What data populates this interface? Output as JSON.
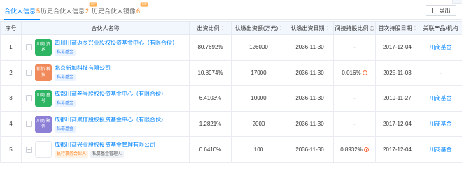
{
  "tabs": [
    {
      "label": "合伙人信息",
      "count": "5",
      "vip": ""
    },
    {
      "label": "历史合伙人信息",
      "count": "2",
      "vip": "VIP"
    },
    {
      "label": "历史合伙人镜像",
      "count": "6",
      "vip": "VIP"
    }
  ],
  "export_label": "导出",
  "columns": {
    "seq": "序号",
    "partner": "合伙人名称",
    "ratio": "出资比例",
    "subscribed": "认缴出资额(万元)",
    "due_date": "认缴出资日期",
    "indirect": "间接持股比例",
    "first_date": "首次持股日期",
    "related": "关联产品/机构"
  },
  "rows": [
    {
      "seq": "1",
      "logo": "川商 资乡",
      "logo_color": "#2db563",
      "name": "四川川商返乡兴业股权投资基金中心（有限合伙）",
      "tags": [
        {
          "text": "私募基金",
          "style": "blue"
        }
      ],
      "ratio": "80.7692%",
      "subscribed": "126000",
      "due_date": "2036-11-30",
      "indirect": "-",
      "first_date": "2017-12-04",
      "related": "川商基金"
    },
    {
      "seq": "2",
      "logo": "新加 科技",
      "logo_color": "#f08a5a",
      "name": "北京新加科技有限公司",
      "tags": [
        {
          "text": "私募基金",
          "style": "blue"
        }
      ],
      "ratio": "10.8974%",
      "subscribed": "17000",
      "due_date": "2036-11-30",
      "indirect": "0.016%",
      "first_date": "2025-11-03",
      "related": "-"
    },
    {
      "seq": "3",
      "logo": "川商 叁号",
      "logo_color": "#2db563",
      "name": "成都川商叁号股权投资基金中心（有限合伙）",
      "tags": [
        {
          "text": "私募基金",
          "style": "blue"
        }
      ],
      "ratio": "6.4103%",
      "subscribed": "10000",
      "due_date": "2036-11-30",
      "indirect": "-",
      "first_date": "2019-11-27",
      "related": "川商基金"
    },
    {
      "seq": "4",
      "logo": "川商 聚信",
      "logo_color": "#8c7fd6",
      "name": "成都川商聚信股权投资基金中心（有限合伙）",
      "tags": [
        {
          "text": "私募基金",
          "style": "blue"
        }
      ],
      "ratio": "1.2821%",
      "subscribed": "2000",
      "due_date": "2036-11-30",
      "indirect": "-",
      "first_date": "2017-12-04",
      "related": "川商基金"
    },
    {
      "seq": "5",
      "logo": "",
      "logo_color": "#ffffff",
      "name": "成都川商兴业股权投资基金管理有限公司",
      "tags": [
        {
          "text": "执行事务合伙人",
          "style": "orange"
        },
        {
          "text": "私募基金管理人",
          "style": "grey"
        }
      ],
      "ratio": "0.6410%",
      "subscribed": "100",
      "due_date": "2036-11-30",
      "indirect": "0.8932%",
      "first_date": "2017-12-04",
      "related": "川商基金"
    }
  ]
}
